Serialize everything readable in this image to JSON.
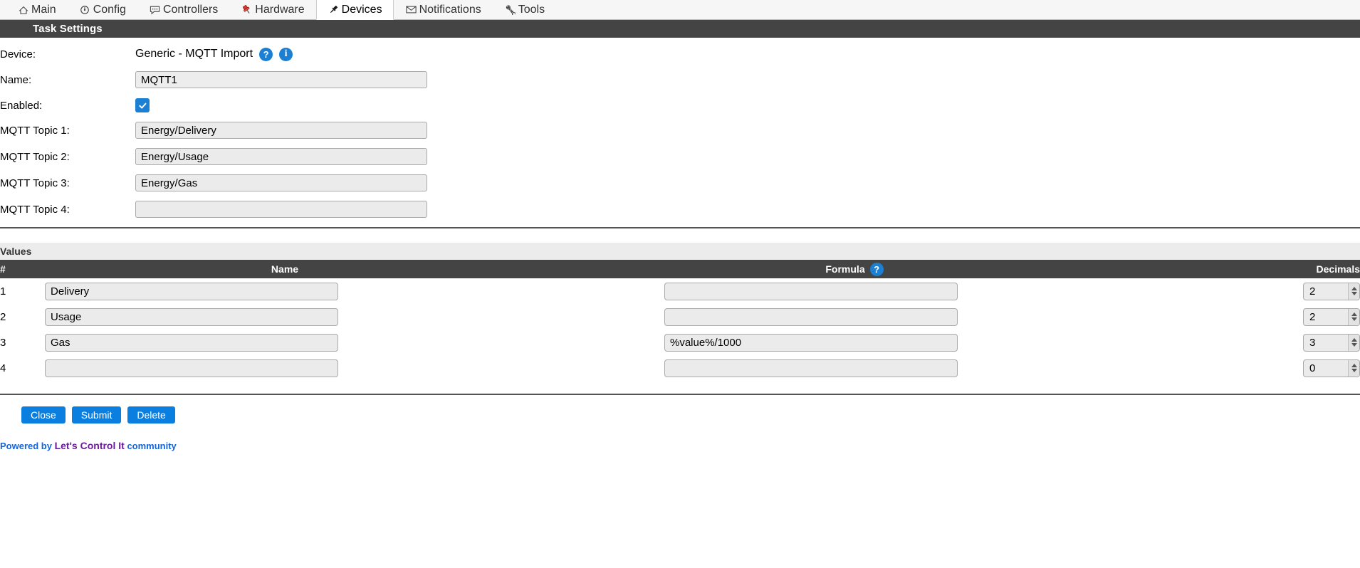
{
  "nav": {
    "tabs": [
      {
        "label": "Main",
        "icon": "home-icon",
        "active": false
      },
      {
        "label": "Config",
        "icon": "gear-icon",
        "active": false
      },
      {
        "label": "Controllers",
        "icon": "speech-bubble-icon",
        "active": false
      },
      {
        "label": "Hardware",
        "icon": "pushpin-icon",
        "active": false
      },
      {
        "label": "Devices",
        "icon": "plug-icon",
        "active": true
      },
      {
        "label": "Notifications",
        "icon": "envelope-icon",
        "active": false
      },
      {
        "label": "Tools",
        "icon": "wrench-icon",
        "active": false
      }
    ]
  },
  "task_settings": {
    "header": "Task Settings",
    "device": {
      "label": "Device:",
      "value": "Generic - MQTT Import",
      "help_icon": "question-mark-icon",
      "info_icon": "info-icon"
    },
    "name": {
      "label": "Name:",
      "value": "MQTT1",
      "placeholder": ""
    },
    "enabled": {
      "label": "Enabled:",
      "checked": true
    },
    "topics": [
      {
        "label": "MQTT Topic 1:",
        "value": "Energy/Delivery",
        "placeholder": ""
      },
      {
        "label": "MQTT Topic 2:",
        "value": "Energy/Usage",
        "placeholder": ""
      },
      {
        "label": "MQTT Topic 3:",
        "value": "Energy/Gas",
        "placeholder": ""
      },
      {
        "label": "MQTT Topic 4:",
        "value": "",
        "placeholder": ""
      }
    ]
  },
  "values": {
    "header": "Values",
    "columns": {
      "num": "#",
      "name": "Name",
      "formula": "Formula",
      "formula_help_icon": "question-mark-icon",
      "decimals": "Decimals"
    },
    "rows": [
      {
        "num": "1",
        "name": "Delivery",
        "formula": "",
        "decimals": "2"
      },
      {
        "num": "2",
        "name": "Usage",
        "formula": "",
        "decimals": "2"
      },
      {
        "num": "3",
        "name": "Gas",
        "formula": "%value%/1000",
        "decimals": "3"
      },
      {
        "num": "4",
        "name": "",
        "formula": "",
        "decimals": "0"
      }
    ]
  },
  "buttons": {
    "close": "Close",
    "submit": "Submit",
    "delete": "Delete"
  },
  "footer": {
    "prefix": "Powered by",
    "brand": "Let's Control It",
    "suffix": "community"
  },
  "colors": {
    "accent_blue": "#0b7fe0",
    "badge_blue": "#1b7fd4",
    "header_dark": "#444444",
    "values_bar": "#ececec",
    "input_bg": "#ebebeb",
    "brand_purple": "#6a1b9a",
    "link_blue": "#1565d8",
    "pushpin_red": "#d9362b"
  }
}
